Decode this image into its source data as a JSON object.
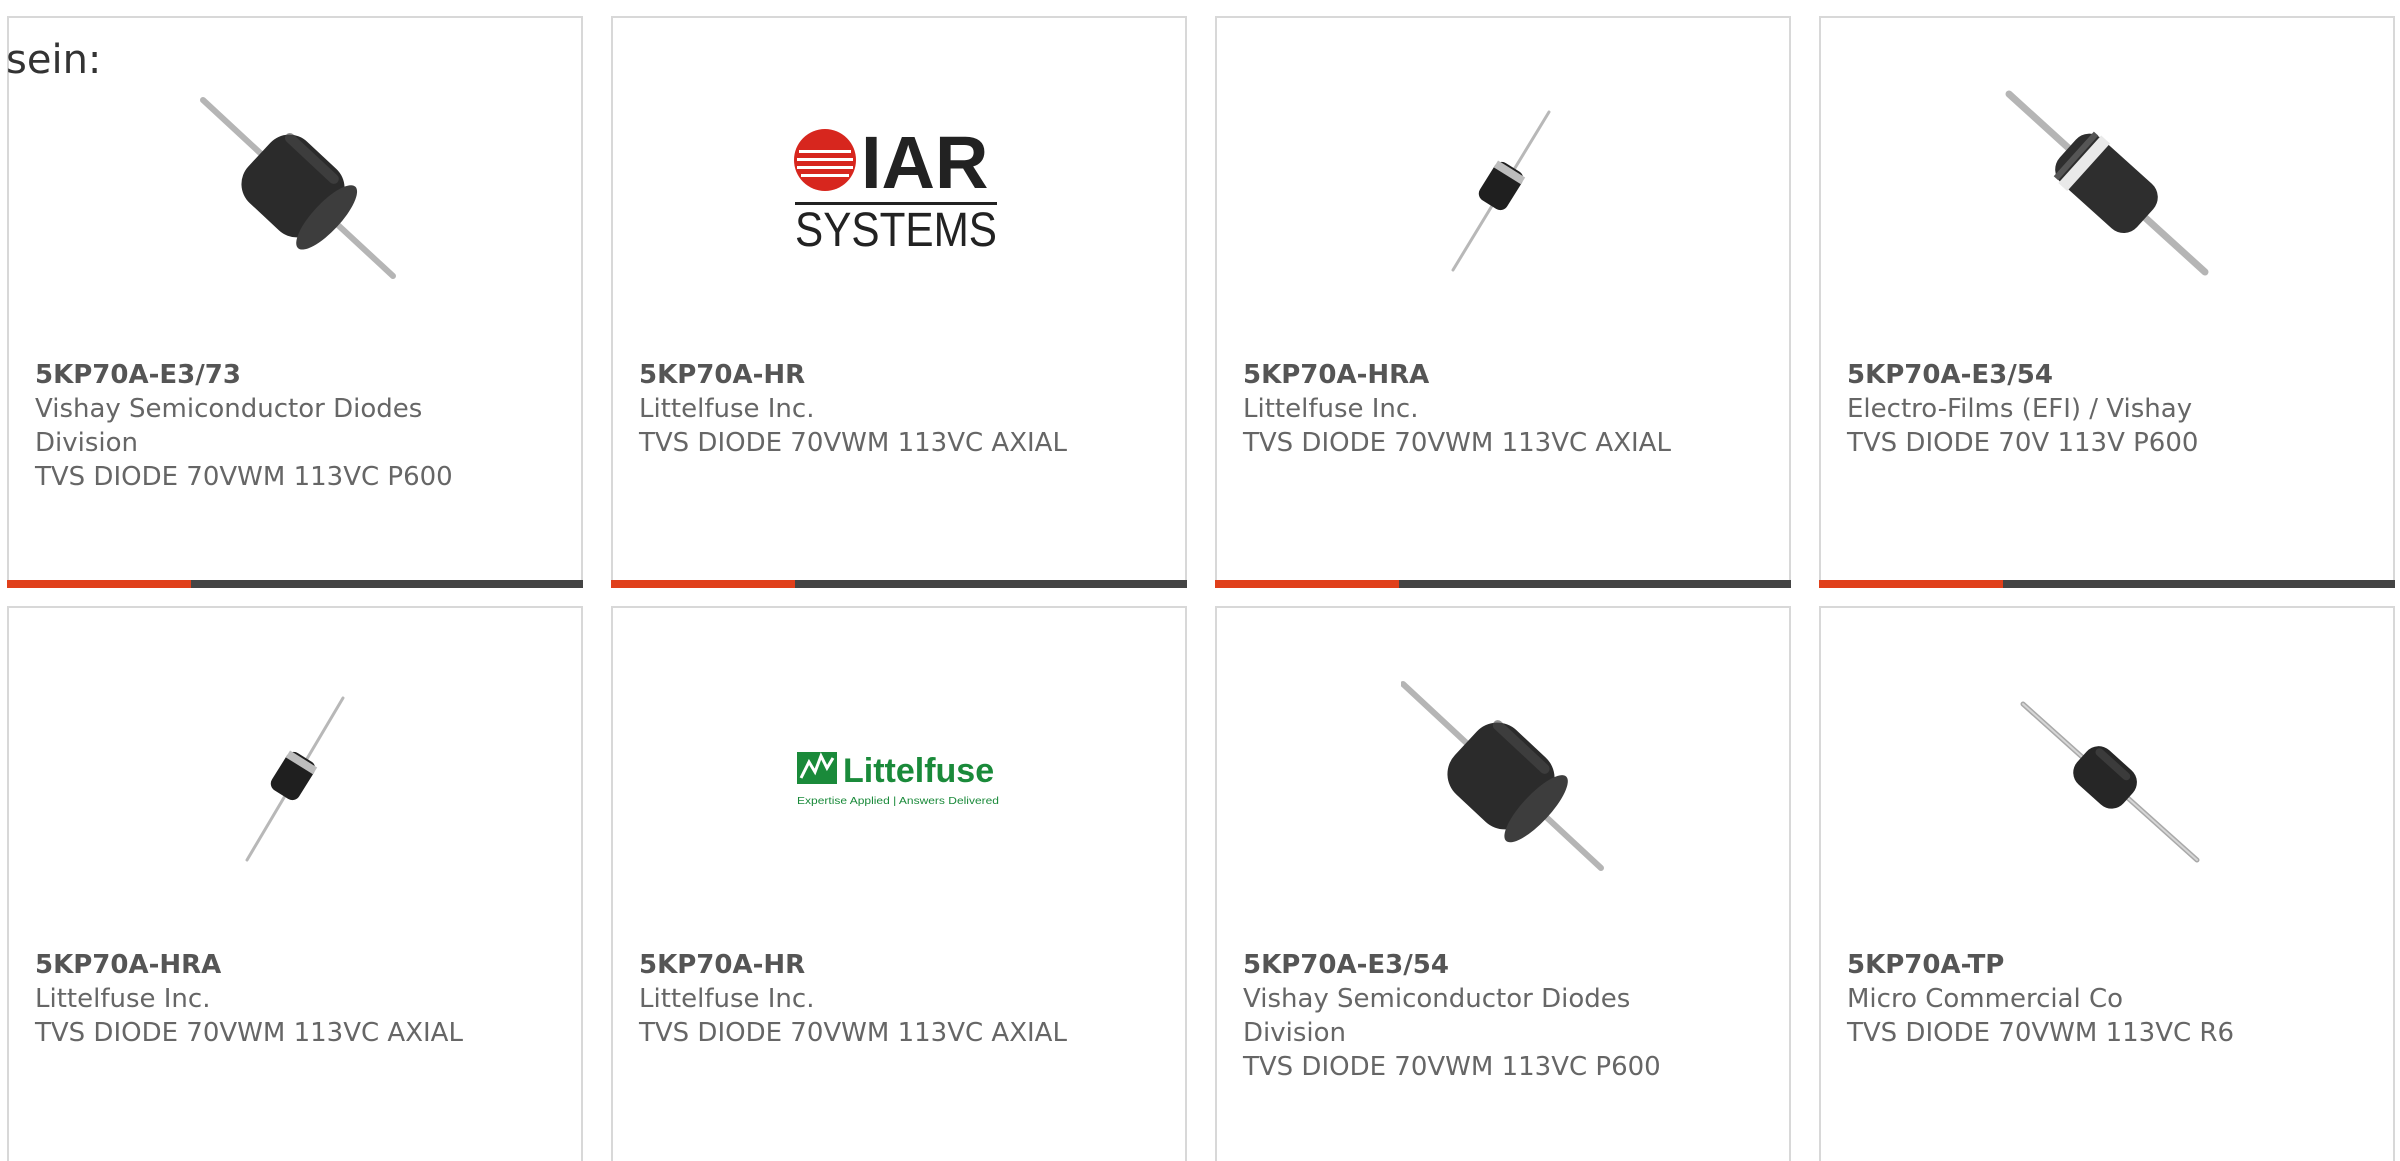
{
  "intro_text": "sein:",
  "colors": {
    "accent": "#e0401b",
    "bar": "#444444",
    "card_border": "#d8d8d8",
    "text": "#666666",
    "part_no": "#555555"
  },
  "products": [
    {
      "part_number": "5KP70A-E3/73",
      "manufacturer": "Vishay Semiconductor Diodes Division",
      "description": "TVS DIODE 70VWM 113VC P600",
      "image": "axial-diode-large-icon"
    },
    {
      "part_number": "5KP70A-HR",
      "manufacturer": "Littelfuse Inc.",
      "description": "TVS DIODE 70VWM 113VC AXIAL",
      "image": "iar-systems-logo",
      "logo_text": [
        "IAR",
        "SYSTEMS"
      ]
    },
    {
      "part_number": "5KP70A-HRA",
      "manufacturer": "Littelfuse Inc.",
      "description": "TVS DIODE 70VWM 113VC AXIAL",
      "image": "axial-diode-small-icon"
    },
    {
      "part_number": "5KP70A-E3/54",
      "manufacturer": "Electro-Films (EFI) / Vishay",
      "description": "TVS DIODE 70V 113V P600",
      "image": "axial-diode-banded-icon"
    },
    {
      "part_number": "5KP70A-HRA",
      "manufacturer": "Littelfuse Inc.",
      "description": "TVS DIODE 70VWM 113VC AXIAL",
      "image": "axial-diode-small-icon"
    },
    {
      "part_number": "5KP70A-HR",
      "manufacturer": "Littelfuse Inc.",
      "description": "TVS DIODE 70VWM 113VC AXIAL",
      "image": "littelfuse-logo",
      "logo_text": [
        "Littelfuse",
        "Expertise Applied | Answers Delivered"
      ]
    },
    {
      "part_number": "5KP70A-E3/54",
      "manufacturer": "Vishay Semiconductor Diodes Division",
      "description": "TVS DIODE 70VWM 113VC P600",
      "image": "axial-diode-large-icon"
    },
    {
      "part_number": "5KP70A-TP",
      "manufacturer": "Micro Commercial Co",
      "description": "TVS DIODE 70VWM 113VC R6",
      "image": "axial-diode-medium-icon"
    }
  ]
}
